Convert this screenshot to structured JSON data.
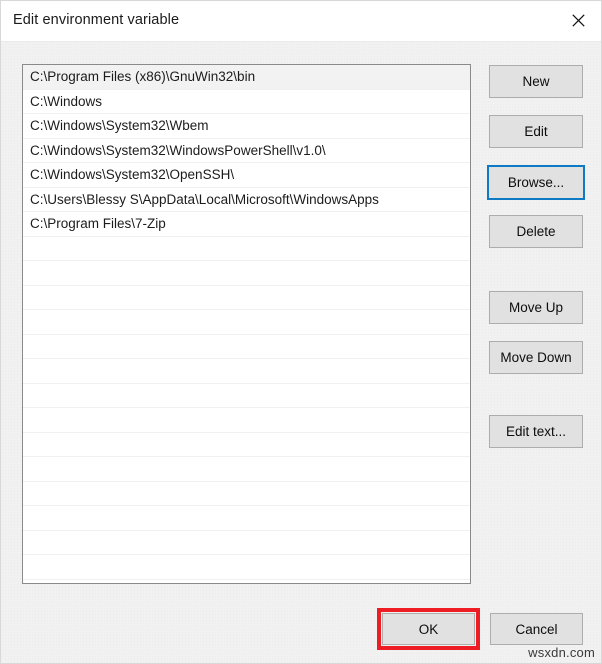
{
  "window": {
    "title": "Edit environment variable",
    "close_icon": "close-icon"
  },
  "list": {
    "selected_index": 0,
    "entries": [
      "C:\\Program Files (x86)\\GnuWin32\\bin",
      "C:\\Windows",
      "C:\\Windows\\System32\\Wbem",
      "C:\\Windows\\System32\\WindowsPowerShell\\v1.0\\",
      "C:\\Windows\\System32\\OpenSSH\\",
      "C:\\Users\\Blessy S\\AppData\\Local\\Microsoft\\WindowsApps",
      "C:\\Program Files\\7-Zip"
    ],
    "empty_row_count": 14
  },
  "side_buttons": {
    "new": "New",
    "edit": "Edit",
    "browse": "Browse...",
    "delete": "Delete",
    "move_up": "Move Up",
    "move_down": "Move Down",
    "edit_text": "Edit text..."
  },
  "footer": {
    "ok": "OK",
    "cancel": "Cancel"
  },
  "annotation": {
    "highlight_color": "#ee1c23",
    "focus_color": "#0e7ac4"
  },
  "watermark": {
    "text": "wsxdn.com"
  }
}
